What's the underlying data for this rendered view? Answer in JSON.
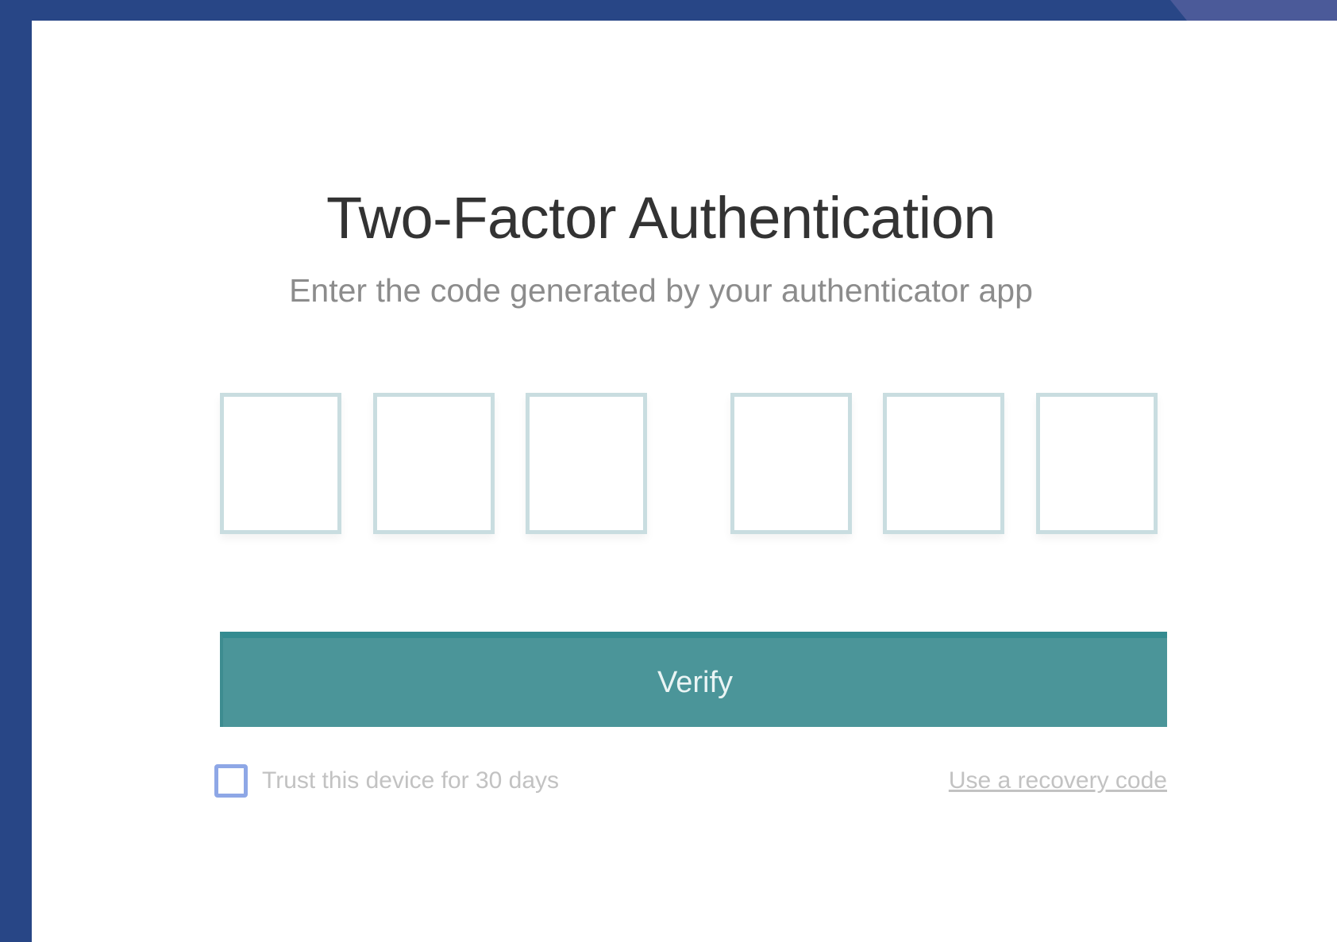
{
  "auth": {
    "title": "Two-Factor Authentication",
    "subtitle": "Enter the code generated by your authenticator app",
    "code_digits": [
      "",
      "",
      "",
      "",
      "",
      ""
    ],
    "verify_label": "Verify",
    "trust_device_label": "Trust this device for 30 days",
    "trust_device_checked": false,
    "recovery_link_label": "Use a recovery code"
  },
  "colors": {
    "frame": "#284686",
    "accent": "#4b9599",
    "input_border": "#c9dde0",
    "checkbox_border": "#8ea7e6"
  }
}
